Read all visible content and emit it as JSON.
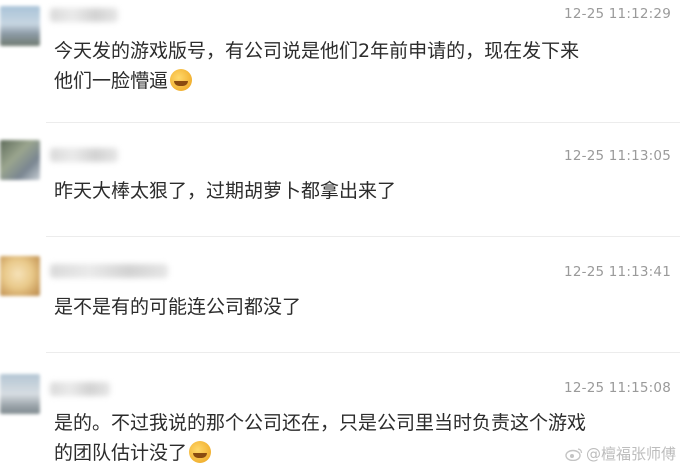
{
  "messages": [
    {
      "time": "12-25 11:12:29",
      "lines": [
        "今天发的游戏版号，有公司说是他们2年前申请的，现在发下来",
        "他们一脸懵逼"
      ],
      "emoji": "laugh-cry"
    },
    {
      "time": "12-25 11:13:05",
      "lines": [
        "昨天大棒太狠了，过期胡萝卜都拿出来了"
      ],
      "emoji": ""
    },
    {
      "time": "12-25 11:13:41",
      "lines": [
        "是不是有的可能连公司都没了"
      ],
      "emoji": ""
    },
    {
      "time": "12-25 11:15:08",
      "lines": [
        "是的。不过我说的那个公司还在，只是公司里当时负责这个游戏",
        "的团队估计没了"
      ],
      "emoji": "laugh-cry"
    }
  ],
  "watermark": {
    "text": "@檀福张师傅",
    "icon": "weibo-icon"
  },
  "colors": {
    "background": "#ffffff",
    "text": "#2c2c2c",
    "timestamp": "#9a9a9a",
    "divider": "#ececec"
  }
}
